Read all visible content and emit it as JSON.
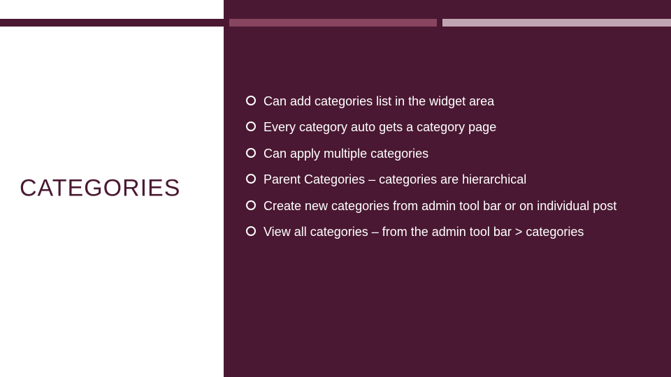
{
  "slide": {
    "title": "CATEGORIES",
    "bullets": [
      "Can add categories list in the widget area",
      "Every category auto gets a category page",
      "Can apply multiple categories",
      "Parent Categories – categories are hierarchical",
      "Create new categories from admin tool bar or on individual post",
      "View all categories – from the admin tool bar > categories"
    ]
  },
  "colors": {
    "brand_dark": "#4a1832",
    "brand_mid": "#884560",
    "brand_light": "#c2a5b2"
  }
}
